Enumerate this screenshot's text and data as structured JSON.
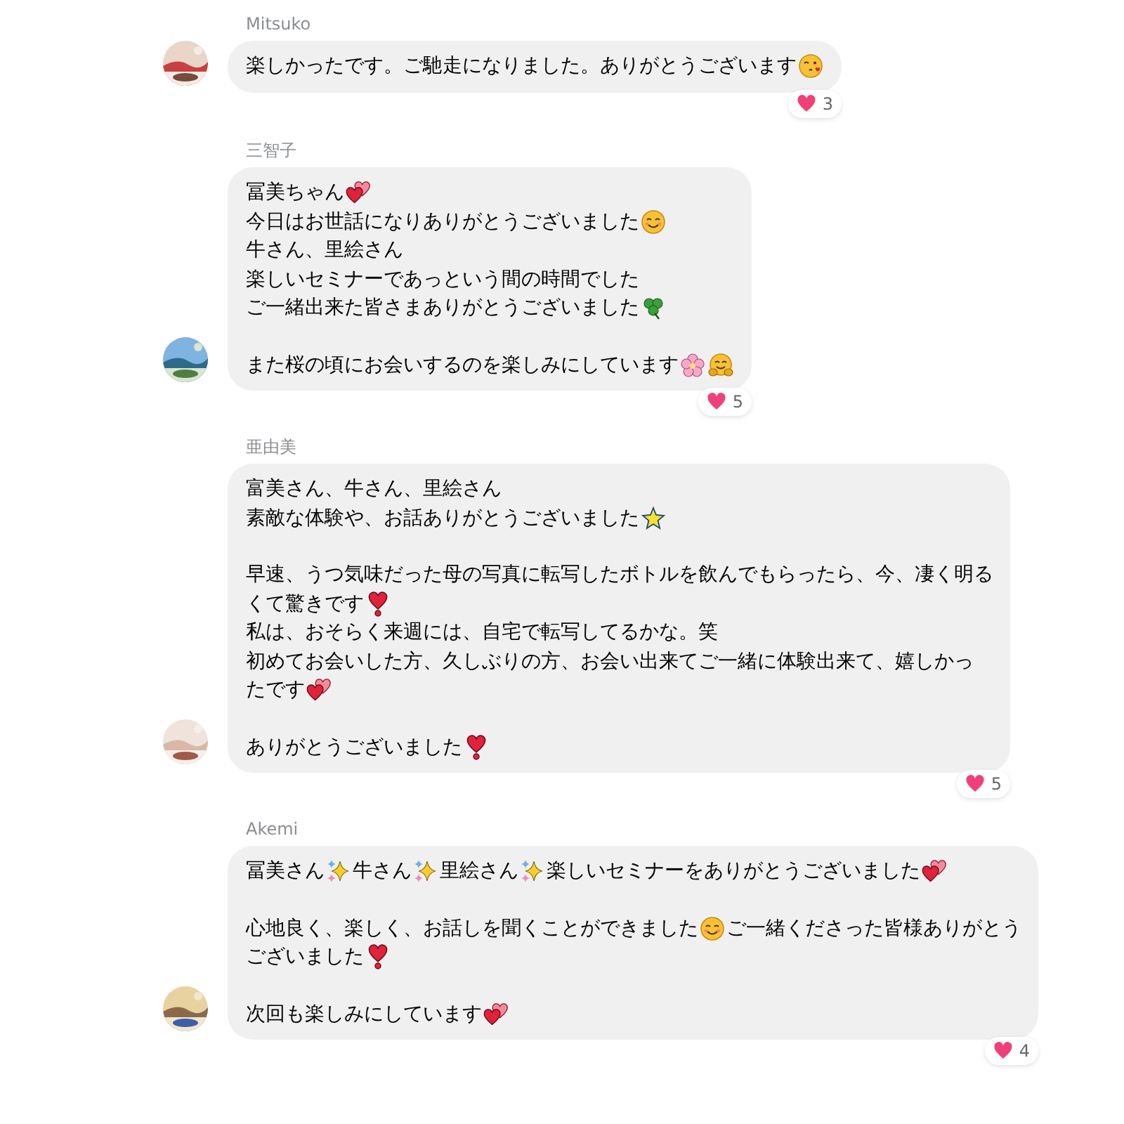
{
  "messages": [
    {
      "sender": "Mitsuko",
      "avatar": {
        "kind": "picture"
      },
      "paragraphs": [
        [
          [
            {
              "kind": "text",
              "text": "楽しかったです。ご馳走になりました。ありがとうございます"
            },
            {
              "kind": "wink-kiss"
            }
          ]
        ]
      ],
      "reaction": {
        "count": "3"
      }
    },
    {
      "sender": "三智子",
      "avatar": {
        "kind": "picture"
      },
      "paragraphs": [
        [
          [
            {
              "kind": "text",
              "text": "冨美ちゃん"
            },
            {
              "kind": "two-hearts"
            }
          ],
          [
            {
              "kind": "text",
              "text": "今日はお世話になりありがとうございました"
            },
            {
              "kind": "smile"
            }
          ],
          [
            {
              "kind": "text",
              "text": "牛さん、里絵さん"
            }
          ],
          [
            {
              "kind": "text",
              "text": "楽しいセミナーであっという間の時間でした"
            }
          ],
          [
            {
              "kind": "text",
              "text": "ご一緒出来た皆さまありがとうございました"
            },
            {
              "kind": "clover"
            }
          ]
        ],
        [
          [
            {
              "kind": "text",
              "text": "また桜の頃にお会いするのを楽しみにしています"
            },
            {
              "kind": "blossom"
            },
            {
              "kind": "hug"
            }
          ]
        ]
      ],
      "reaction": {
        "count": "5"
      }
    },
    {
      "sender": "亜由美",
      "avatar": {
        "kind": "picture"
      },
      "paragraphs": [
        [
          [
            {
              "kind": "text",
              "text": "富美さん、牛さん、里絵さん"
            }
          ],
          [
            {
              "kind": "text",
              "text": "素敵な体験や、お話ありがとうございました"
            },
            {
              "kind": "star"
            }
          ]
        ],
        [
          [
            {
              "kind": "text",
              "text": "早速、うつ気味だった母の写真に転写したボトルを飲んでもらったら、今、凄く明る"
            }
          ],
          [
            {
              "kind": "text",
              "text": "くて驚きです"
            },
            {
              "kind": "heart-exclamation"
            }
          ],
          [
            {
              "kind": "text",
              "text": "私は、おそらく来週には、自宅で転写してるかな。笑"
            }
          ],
          [
            {
              "kind": "text",
              "text": "初めてお会いした方、久しぶりの方、お会い出来てご一緒に体験出来て、嬉しかっ"
            }
          ],
          [
            {
              "kind": "text",
              "text": "たです"
            },
            {
              "kind": "two-hearts"
            }
          ]
        ],
        [
          [
            {
              "kind": "text",
              "text": "ありがとうございました"
            },
            {
              "kind": "heart-exclamation"
            }
          ]
        ]
      ],
      "reaction": {
        "count": "5"
      }
    },
    {
      "sender": "Akemi",
      "avatar": {
        "kind": "picture"
      },
      "paragraphs": [
        [
          [
            {
              "kind": "text",
              "text": "冨美さん"
            },
            {
              "kind": "sparkles"
            },
            {
              "kind": "text",
              "text": "牛さん"
            },
            {
              "kind": "sparkles"
            },
            {
              "kind": "text",
              "text": "里絵さん"
            },
            {
              "kind": "sparkles"
            },
            {
              "kind": "text",
              "text": "楽しいセミナーをありがとうございました"
            },
            {
              "kind": "two-hearts"
            }
          ]
        ],
        [
          [
            {
              "kind": "text",
              "text": "心地良く、楽しく、お話しを聞くことができました"
            },
            {
              "kind": "smile"
            },
            {
              "kind": "text",
              "text": "ご一緒くださった皆様ありがとう"
            }
          ],
          [
            {
              "kind": "text",
              "text": "ございました"
            },
            {
              "kind": "heart-exclamation"
            }
          ]
        ],
        [
          [
            {
              "kind": "text",
              "text": "次回も楽しみにしています"
            },
            {
              "kind": "two-hearts"
            }
          ]
        ]
      ],
      "reaction": {
        "count": "4"
      }
    }
  ]
}
